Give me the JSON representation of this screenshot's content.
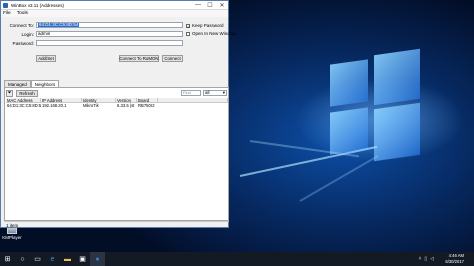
{
  "window": {
    "title": "WinBox v3.11 (Addresses)",
    "minimize": "—",
    "maximize": "☐",
    "close": "✕"
  },
  "menu": [
    "File",
    "Tools"
  ],
  "login": {
    "connect_to_label": "Connect To:",
    "connect_to_value": "64:D1:3C:C5:8D:54",
    "login_label": "Login:",
    "login_value": "admin",
    "password_label": "Password:",
    "password_value": "",
    "keep_password_label": "Keep Password",
    "keep_password_checked": true,
    "open_new_window_label": "Open In New Window",
    "open_new_window_checked": false,
    "add_set_button": "Add/Set",
    "connect_romon_button": "Connect To RoMON",
    "connect_button": "Connect"
  },
  "tabs": [
    "Managed",
    "Neighbors"
  ],
  "active_tab": "Neighbors",
  "toolbar": {
    "filter_icon": "filter-icon",
    "refresh_button": "Refresh",
    "find_placeholder": "Find",
    "scope_value": "all"
  },
  "table": {
    "columns": [
      "MAC Address",
      "IP Address",
      "Identity",
      "Version",
      "Board"
    ],
    "rows": [
      [
        "64:D1:3C:C5:8D:54",
        "192.168.20.1",
        "MikroTik",
        "6.33.5 (st",
        "RB750r2"
      ]
    ]
  },
  "status": "1 item",
  "desktop_icon_label": "KMPlayer",
  "taskbar": {
    "start_icon": "windows-logo-icon",
    "time": "4:46 AM",
    "date": "6/30/2017"
  },
  "colors": {
    "selection": "#2d6fd0",
    "taskbar": "#141a24",
    "wallpaper_accent": "#0d4fa8"
  }
}
